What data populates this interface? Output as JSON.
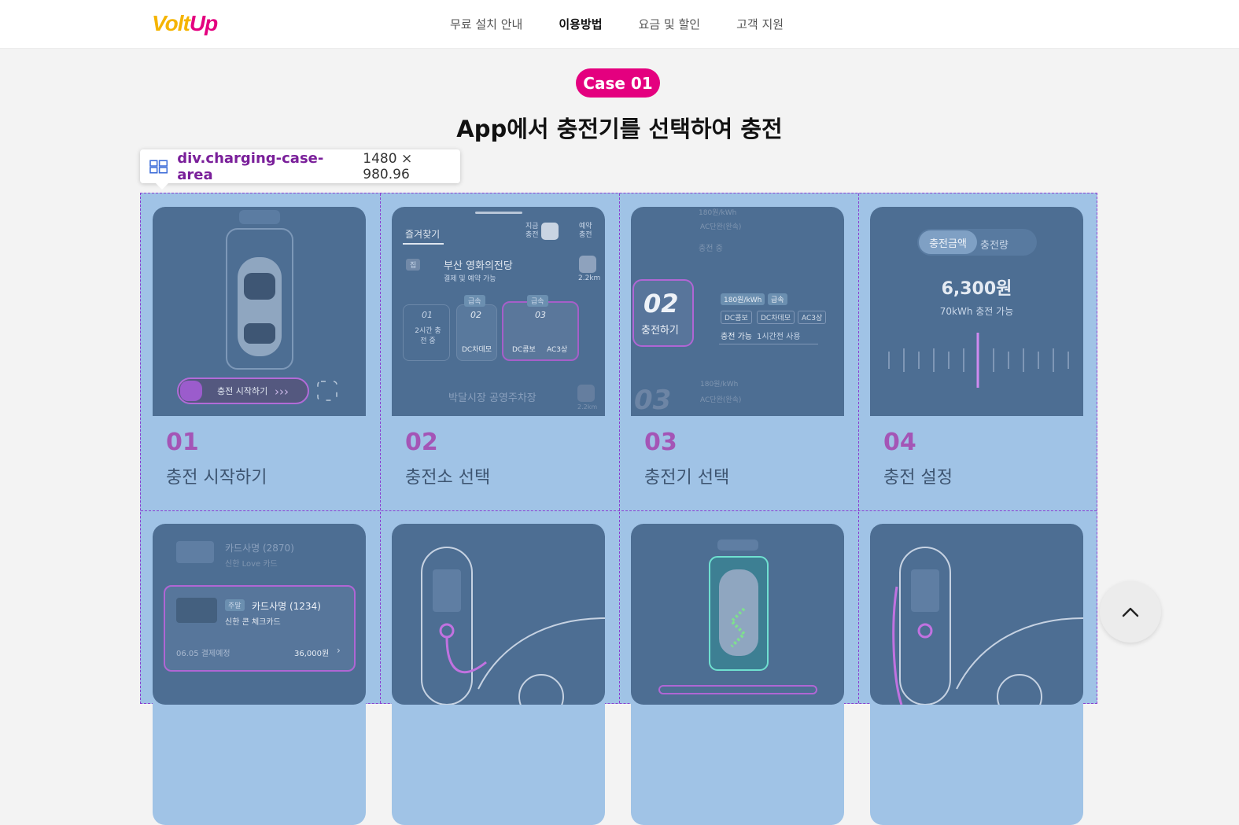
{
  "header": {
    "logo": {
      "part1": "Volt",
      "part2": "Up"
    },
    "nav": [
      {
        "label": "무료 설치 안내"
      },
      {
        "label": "이용방법",
        "active": true
      },
      {
        "label": "요금 및 할인"
      },
      {
        "label": "고객 지원"
      }
    ]
  },
  "section": {
    "badge": "Case 01",
    "title": "App에서 충전기를 선택하여 충전"
  },
  "inspector": {
    "selector": "div.charging-case-area",
    "size": "1480 × 980.96"
  },
  "steps": [
    {
      "num": "01",
      "label": "충전 시작하기",
      "screen": {
        "button": "충전 시작하기"
      }
    },
    {
      "num": "02",
      "label": "충전소 선택",
      "screen": {
        "tab": "즐겨찾기",
        "now": "지금 충전",
        "reserve": "예약 충전",
        "tag1": "집",
        "station": "부산 영화의전당",
        "sub": "결제 및 예약 가능",
        "dist": "2.2km",
        "slot1": {
          "num": "01",
          "status": "2시간 충전 중"
        },
        "slot2": {
          "num": "02",
          "speed": "급속",
          "type": "DC차데모"
        },
        "slot3": {
          "num": "03",
          "speed": "급속",
          "type1": "DC콤보",
          "type2": "AC3상"
        },
        "station2": "박달시장 공영주차장",
        "dist2": "2.2km"
      }
    },
    {
      "num": "03",
      "label": "충전기 선택",
      "screen": {
        "top1": "180원/kWh",
        "top2": "AC단완(완속)",
        "top3": "충전 중",
        "big": "02",
        "action": "충전하기",
        "price": "180원/kWh",
        "speed": "급속",
        "c1": "DC콤보",
        "c2": "DC차데모",
        "c3": "AC3상",
        "avail": "충전 가능",
        "last": "1시간전 사용",
        "next": "03",
        "b1": "180원/kWh",
        "b2": "AC단완(완속)"
      }
    },
    {
      "num": "04",
      "label": "충전 설정",
      "screen": {
        "tab1": "충전금액",
        "tab2": "충전량",
        "amount": "6,300원",
        "sub": "70kWh 충전 가능"
      }
    },
    {
      "screen": {
        "card1": "카드사명 (2870)",
        "card1sub": "신한 Love 카드",
        "tag": "주말",
        "card2": "카드사명 (1234)",
        "card2sub": "신한 콘 체크카드",
        "date": "06.05 결제예정",
        "amount": "36,000원"
      }
    },
    {
      "screen": {}
    },
    {
      "screen": {}
    },
    {
      "screen": {}
    }
  ]
}
